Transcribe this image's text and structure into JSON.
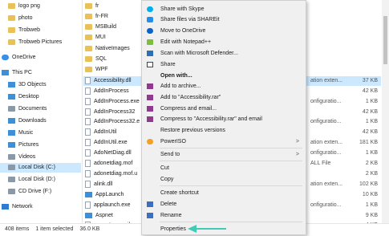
{
  "colors": {
    "selection": "#cce8ff",
    "arrow": "#41cbb6",
    "menu_bg": "#f0f0f0"
  },
  "nav": [
    {
      "label": "logo png",
      "icon": "folder-icon"
    },
    {
      "label": "photo",
      "icon": "folder-icon"
    },
    {
      "label": "Trobweb",
      "icon": "folder-icon"
    },
    {
      "label": "Trobweb Pictures",
      "icon": "folder-icon"
    },
    {
      "label": "OneDrive",
      "icon": "cloud-icon"
    },
    {
      "label": "This PC",
      "icon": "pc-icon"
    },
    {
      "label": "3D Objects",
      "icon": "folder-icon"
    },
    {
      "label": "Desktop",
      "icon": "folder-icon"
    },
    {
      "label": "Documents",
      "icon": "folder-icon"
    },
    {
      "label": "Downloads",
      "icon": "folder-icon"
    },
    {
      "label": "Music",
      "icon": "folder-icon"
    },
    {
      "label": "Pictures",
      "icon": "folder-icon"
    },
    {
      "label": "Videos",
      "icon": "folder-icon"
    },
    {
      "label": "Local Disk (C:)",
      "icon": "drive-icon"
    },
    {
      "label": "Local Disk (D:)",
      "icon": "drive-icon"
    },
    {
      "label": "CD Drive (F:)",
      "icon": "drive-icon"
    },
    {
      "label": "Network",
      "icon": "network-icon"
    }
  ],
  "files": [
    {
      "name": "fr",
      "type": "",
      "size": ""
    },
    {
      "name": "fr-FR",
      "type": "",
      "size": ""
    },
    {
      "name": "MSBuild",
      "type": "",
      "size": ""
    },
    {
      "name": "MUI",
      "type": "",
      "size": ""
    },
    {
      "name": "NativeImages",
      "type": "",
      "size": ""
    },
    {
      "name": "SQL",
      "type": "",
      "size": ""
    },
    {
      "name": "WPF",
      "type": "",
      "size": ""
    },
    {
      "name": "Accessibility.dll",
      "type": "ation exten...",
      "size": "37 KB"
    },
    {
      "name": "AddInProcess",
      "type": "",
      "size": "42 KB"
    },
    {
      "name": "AddInProcess.exe",
      "type": "onfiguratio...",
      "size": "1 KB"
    },
    {
      "name": "AddInProcess32",
      "type": "",
      "size": "42 KB"
    },
    {
      "name": "AddInProcess32.e",
      "type": "onfiguratio...",
      "size": "1 KB"
    },
    {
      "name": "AddInUtil",
      "type": "",
      "size": "42 KB"
    },
    {
      "name": "AddInUtil.exe",
      "type": "ation exten...",
      "size": "181 KB"
    },
    {
      "name": "AdoNetDiag.dll",
      "type": "onfiguratio...",
      "size": "1 KB"
    },
    {
      "name": "adonetdiag.mof",
      "type": "ALL File",
      "size": "2 KB"
    },
    {
      "name": "adonetdiag.mof.u",
      "type": "",
      "size": "2 KB"
    },
    {
      "name": "alink.dll",
      "type": "ation exten...",
      "size": "102 KB"
    },
    {
      "name": "AppLaunch",
      "type": "",
      "size": "10 KB"
    },
    {
      "name": "applaunch.exe",
      "type": "onfiguratio...",
      "size": "1 KB"
    },
    {
      "name": "Aspnet",
      "type": "",
      "size": "9 KB"
    },
    {
      "name": "aspnet_compiler",
      "type": "",
      "size": "4 KB"
    }
  ],
  "context_menu": {
    "items": [
      {
        "label": "Share with Skype",
        "icon": "skype-icon"
      },
      {
        "label": "Share files via SHAREit",
        "icon": "shareit-icon"
      },
      {
        "label": "Move to OneDrive",
        "icon": "onedrive-icon"
      },
      {
        "label": "Edit with Notepad++",
        "icon": "notepadpp-icon"
      },
      {
        "label": "Scan with Microsoft Defender...",
        "icon": "defender-icon"
      },
      {
        "label": "Share",
        "icon": "share-icon"
      },
      {
        "label": "Open with...",
        "bold": true
      },
      {
        "label": "Add to archive...",
        "icon": "winrar-icon"
      },
      {
        "label": "Add to \"Accessibility.rar\"",
        "icon": "winrar-icon"
      },
      {
        "label": "Compress and email...",
        "icon": "winrar-icon"
      },
      {
        "label": "Compress to \"Accessibility.rar\" and email",
        "icon": "winrar-icon"
      },
      {
        "label": "Restore previous versions"
      },
      {
        "label": "PowerISO",
        "icon": "poweriso-icon",
        "submenu": true
      },
      {
        "label": "Send to",
        "submenu": true
      },
      {
        "label": "Cut"
      },
      {
        "label": "Copy"
      },
      {
        "label": "Create shortcut"
      },
      {
        "label": "Delete",
        "icon": "shield-icon"
      },
      {
        "label": "Rename",
        "icon": "shield-icon"
      },
      {
        "label": "Properties"
      }
    ],
    "submenu_glyph": ">"
  },
  "status": {
    "count": "408 items",
    "selected": "1 item selected",
    "size": "36.0 KB"
  }
}
